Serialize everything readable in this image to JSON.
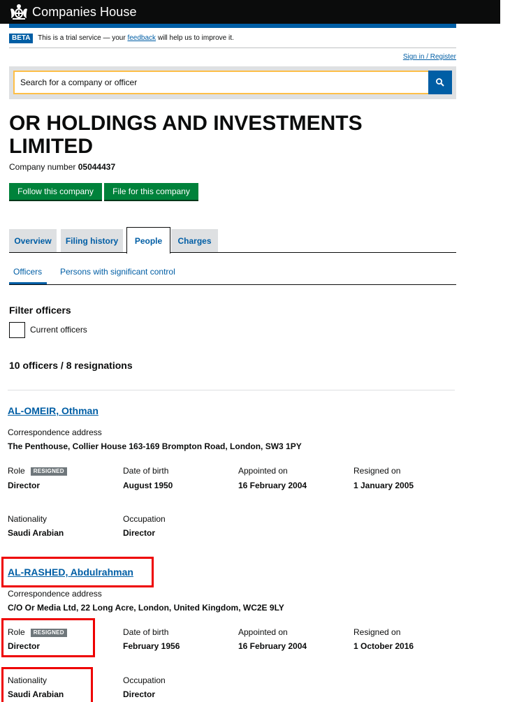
{
  "header": {
    "brand": "Companies House"
  },
  "beta": {
    "tag": "BETA",
    "text_before": "This is a trial service — your ",
    "link": "feedback",
    "text_after": " will help us to improve it."
  },
  "signin": "Sign in / Register",
  "search": {
    "placeholder": "Search for a company or officer"
  },
  "company": {
    "name": "OR HOLDINGS AND INVESTMENTS LIMITED",
    "number_label": "Company number",
    "number": "05044437"
  },
  "buttons": {
    "follow": "Follow this company",
    "file": "File for this company"
  },
  "tabs": [
    {
      "label": "Overview"
    },
    {
      "label": "Filing history"
    },
    {
      "label": "People"
    },
    {
      "label": "Charges"
    }
  ],
  "subtabs": [
    {
      "label": "Officers"
    },
    {
      "label": "Persons with significant control"
    }
  ],
  "filter": {
    "heading": "Filter officers",
    "checkbox_label": "Current officers"
  },
  "officer_count": "10 officers / 8 resignations",
  "labels": {
    "correspondence": "Correspondence address",
    "role": "Role",
    "dob": "Date of birth",
    "appointed": "Appointed on",
    "resigned": "Resigned on",
    "nationality": "Nationality",
    "occupation": "Occupation",
    "resigned_tag": "RESIGNED"
  },
  "officers": [
    {
      "name": "AL-OMEIR, Othman",
      "address": "The Penthouse, Collier House 163-169 Brompton Road, London, SW3 1PY",
      "role": "Director",
      "dob": "August 1950",
      "appointed": "16 February 2004",
      "resigned": "1 January 2005",
      "nationality": "Saudi Arabian",
      "occupation": "Director"
    },
    {
      "name": "AL-RASHED, Abdulrahman",
      "address": "C/O Or Media Ltd, 22 Long Acre, London, United Kingdom, WC2E 9LY",
      "role": "Director",
      "dob": "February 1956",
      "appointed": "16 February 2004",
      "resigned": "1 October 2016",
      "nationality": "Saudi Arabian",
      "occupation": "Director"
    }
  ],
  "colors": {
    "header_bg": "#0b0c0c",
    "link_blue": "#005ea5",
    "button_green": "#00823b",
    "search_focus": "#ffbf47",
    "annotation_red": "#ee0000"
  }
}
